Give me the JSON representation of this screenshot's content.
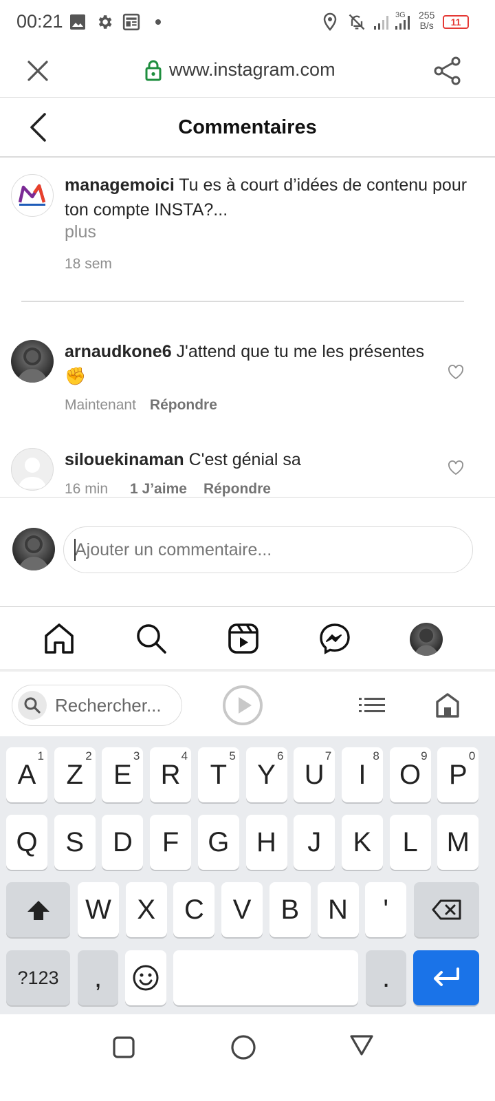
{
  "status_bar": {
    "time": "00:21",
    "speed_value": "255",
    "speed_unit": "B/s",
    "battery": "11",
    "network": "3G",
    "icons": [
      "image-icon",
      "settings-icon",
      "news-icon",
      "dot-icon",
      "location-icon",
      "mute-bell-icon",
      "signal-icon",
      "signal-3g-icon",
      "battery-icon"
    ]
  },
  "browser": {
    "url": "www.instagram.com",
    "icons": [
      "close-icon",
      "lock-icon",
      "share-icon"
    ]
  },
  "header": {
    "title": "Commentaires"
  },
  "caption": {
    "username": "managemoici",
    "text": " Tu es à court d’idées de contenu pour ton compte INSTA?...",
    "more": "plus",
    "time": "18 sem"
  },
  "comments": [
    {
      "username": "arnaudkone6",
      "text": " J'attend que tu me les présentes✊",
      "time": "Maintenant",
      "likes": "",
      "reply": "Répondre"
    },
    {
      "username": "silouekinaman",
      "text": " C'est génial sa",
      "time": "16 min",
      "likes": "1 J’aime",
      "reply": "Répondre"
    }
  ],
  "composer": {
    "placeholder": "Ajouter un commentaire..."
  },
  "bottom_nav": [
    "home-icon",
    "search-icon",
    "reels-icon",
    "messenger-icon",
    "profile-avatar"
  ],
  "keyboard_toolbar": {
    "search_placeholder": "Rechercher..."
  },
  "keyboard": {
    "row1": [
      {
        "k": "A",
        "n": "1"
      },
      {
        "k": "Z",
        "n": "2"
      },
      {
        "k": "E",
        "n": "3"
      },
      {
        "k": "R",
        "n": "4"
      },
      {
        "k": "T",
        "n": "5"
      },
      {
        "k": "Y",
        "n": "6"
      },
      {
        "k": "U",
        "n": "7"
      },
      {
        "k": "I",
        "n": "8"
      },
      {
        "k": "O",
        "n": "9"
      },
      {
        "k": "P",
        "n": "0"
      }
    ],
    "row2": [
      "Q",
      "S",
      "D",
      "F",
      "G",
      "H",
      "J",
      "K",
      "L",
      "M"
    ],
    "row3": [
      "W",
      "X",
      "C",
      "V",
      "B",
      "N",
      "'"
    ],
    "symbols_key": "?123",
    "comma_key": ",",
    "period_key": "."
  },
  "colors": {
    "accent_blue": "#1a73e8",
    "lock_green": "#1e8e3e",
    "battery_red": "#e53935"
  }
}
